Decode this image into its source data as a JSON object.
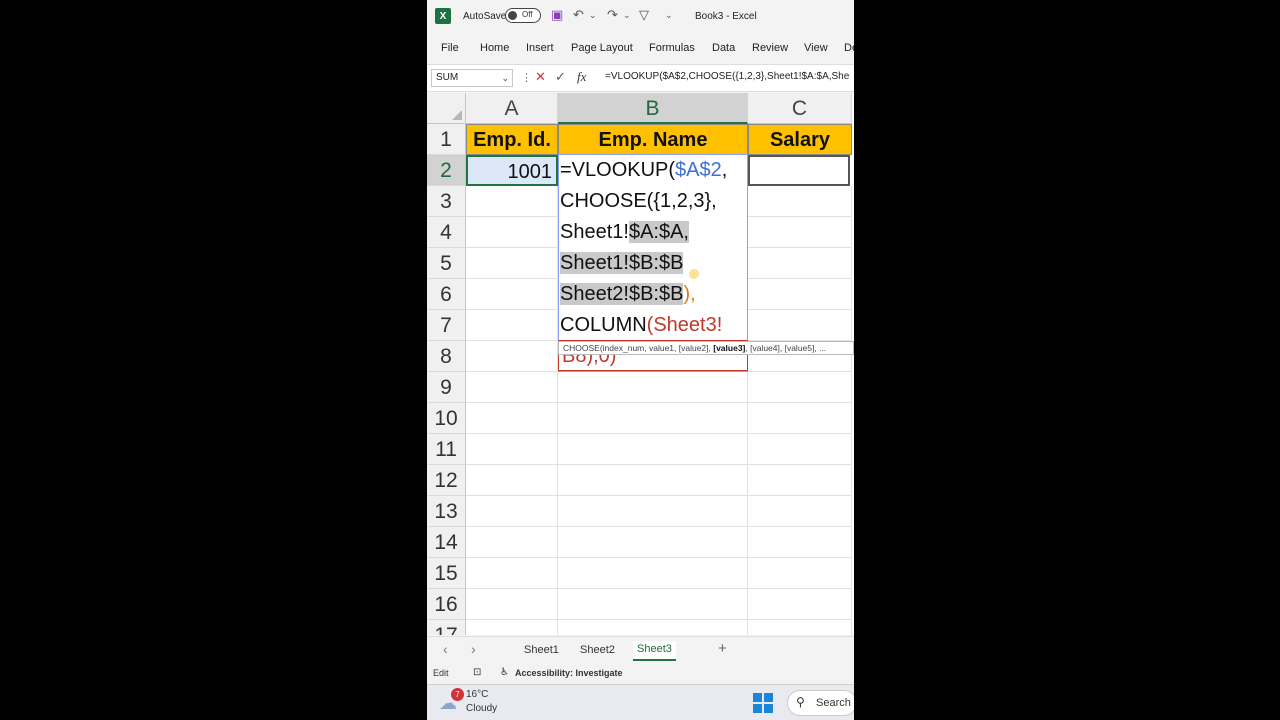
{
  "window": {
    "app_logo": "X",
    "autosave_label": "AutoSave",
    "autosave_state": "Off",
    "title": "Book3 - Excel",
    "icons": [
      "save-icon",
      "undo-icon",
      "redo-icon",
      "filter-icon",
      "customize-icon"
    ]
  },
  "ribbon": {
    "tabs": [
      "File",
      "Home",
      "Insert",
      "Page Layout",
      "Formulas",
      "Data",
      "Review",
      "View",
      "De"
    ]
  },
  "formula_bar": {
    "name_box": "SUM",
    "cancel_icon": "✕",
    "enter_icon": "✓",
    "fx_label": "fx",
    "formula": "=VLOOKUP($A$2,CHOOSE({1,2,3},Sheet1!$A:$A,She"
  },
  "grid": {
    "columns": [
      "A",
      "B",
      "C"
    ],
    "rows": [
      "1",
      "2",
      "3",
      "4",
      "5",
      "6",
      "7",
      "8",
      "9",
      "10",
      "11",
      "12",
      "13",
      "14",
      "15",
      "16",
      "17"
    ],
    "headers": {
      "a1": "Emp. Id.",
      "b1": "Emp. Name",
      "c1": "Salary"
    },
    "a2": "1001",
    "editor_lines": {
      "l1_a": "=VLOOKUP(",
      "l1_ref": "$A$2",
      "l1_b": ",",
      "l2_a": "CHOOSE(",
      "l2_b": "{1,2,3},",
      "l3_a": "Sheet1!",
      "l3_hl": "$A:$A,",
      "l4_hl": "Sheet1!$B:$B",
      "l5_hl": "Sheet2!$B:$B",
      "l5_b": "),",
      "l6_a": "COLUMN",
      "l6_ref": "(Sheet3!",
      "l7": "B8),0)"
    },
    "tooltip": {
      "pre": "CHOOSE(index_num, value1, [value2], ",
      "bold": "[value3]",
      "post": ", [value4], [value5], ..."
    }
  },
  "sheet_tabs": {
    "prev": "‹",
    "next": "›",
    "tabs": [
      "Sheet1",
      "Sheet2",
      "Sheet3"
    ],
    "active": "Sheet3",
    "add": "+"
  },
  "status_bar": {
    "mode": "Edit",
    "accessibility": "Accessibility: Investigate"
  },
  "taskbar": {
    "weather_badge": "7",
    "temperature": "16°C",
    "condition": "Cloudy",
    "search_label": "Search"
  }
}
